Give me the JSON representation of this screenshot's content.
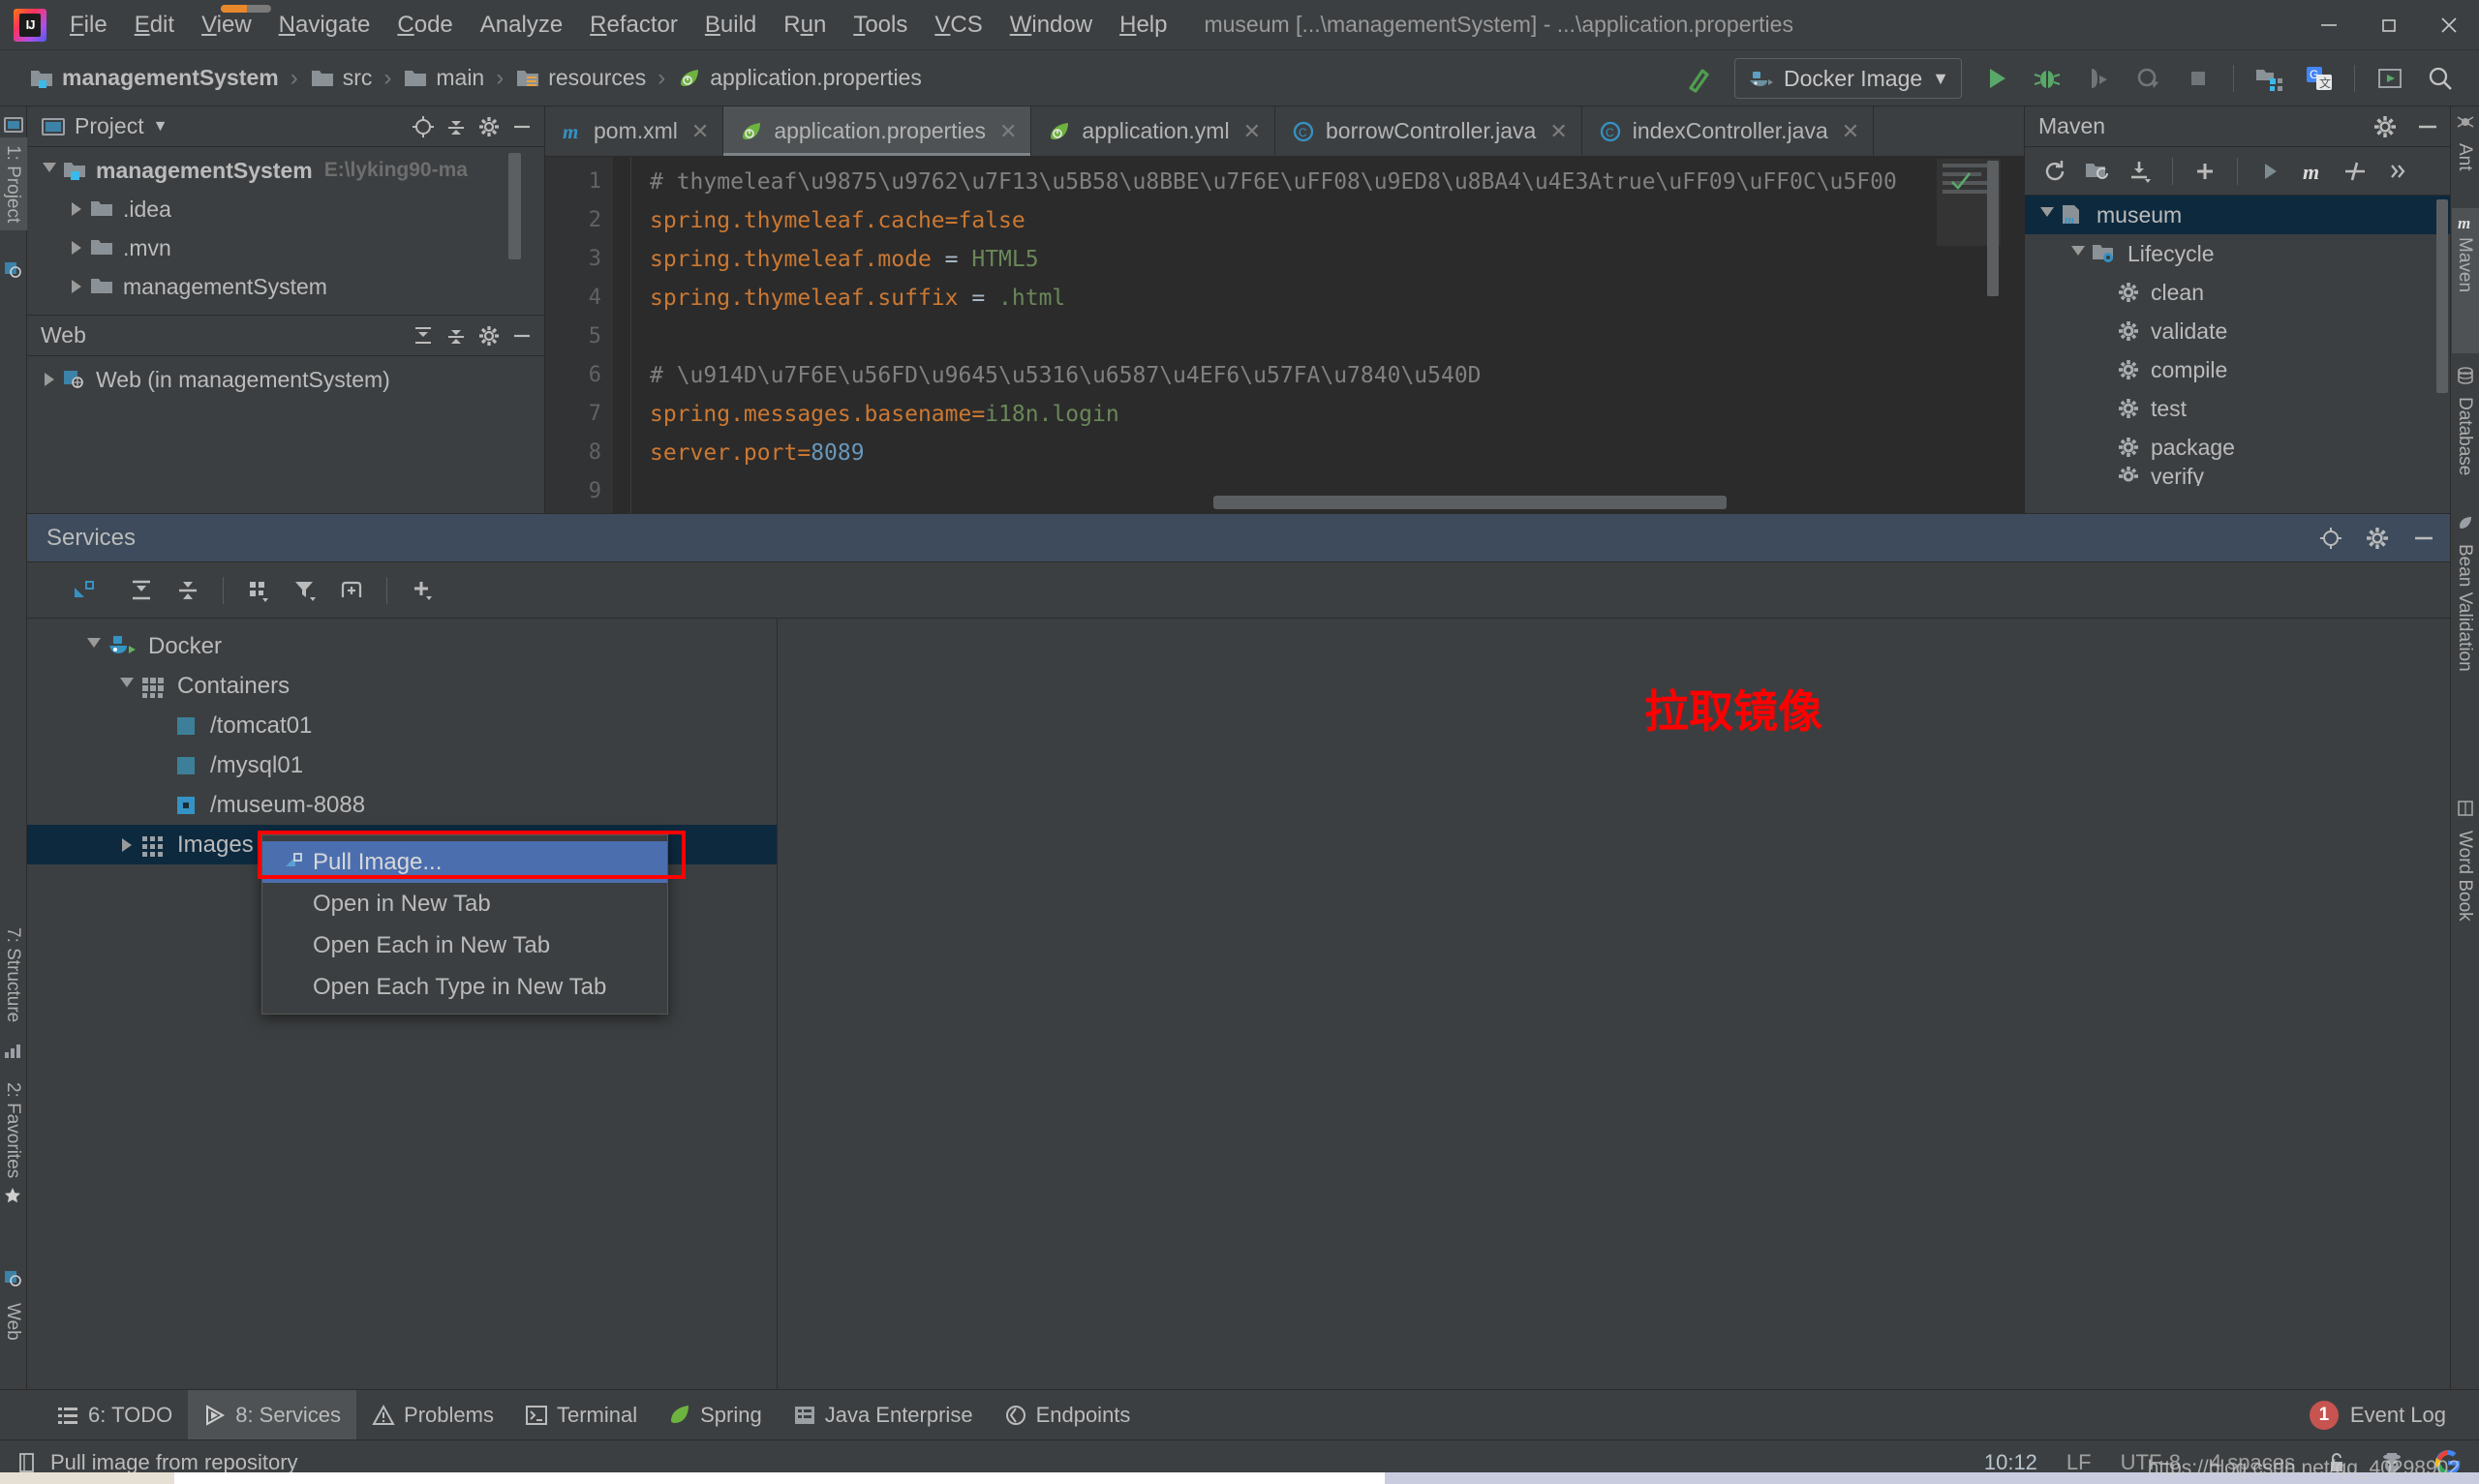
{
  "window": {
    "title": "museum [...\\managementSystem] - ...\\application.properties",
    "minimize": "—",
    "maximize": "❐",
    "close": "✕"
  },
  "menubar": {
    "items": [
      {
        "label": "File",
        "mnemonic": "F"
      },
      {
        "label": "Edit",
        "mnemonic": "E"
      },
      {
        "label": "View",
        "mnemonic": "V"
      },
      {
        "label": "Navigate",
        "mnemonic": "N"
      },
      {
        "label": "Code",
        "mnemonic": "C"
      },
      {
        "label": "Analyze",
        "mnemonic": ""
      },
      {
        "label": "Refactor",
        "mnemonic": "R"
      },
      {
        "label": "Build",
        "mnemonic": "B"
      },
      {
        "label": "Run",
        "mnemonic": "R"
      },
      {
        "label": "Tools",
        "mnemonic": "T"
      },
      {
        "label": "VCS",
        "mnemonic": "V"
      },
      {
        "label": "Window",
        "mnemonic": "W"
      },
      {
        "label": "Help",
        "mnemonic": "H"
      }
    ]
  },
  "breadcrumb": {
    "items": [
      {
        "label": "managementSystem",
        "icon": "module-folder-icon",
        "bold": true
      },
      {
        "label": "src",
        "icon": "folder-icon",
        "bold": false
      },
      {
        "label": "main",
        "icon": "folder-icon",
        "bold": false
      },
      {
        "label": "resources",
        "icon": "resources-folder-icon",
        "bold": false
      },
      {
        "label": "application.properties",
        "icon": "spring-leaf-icon",
        "bold": false
      }
    ]
  },
  "toolbar": {
    "build_icon": "hammer-icon",
    "run_config": "Docker Image",
    "run_config_icon": "docker-whale-icon",
    "dropdown_caret": "▼",
    "buttons": [
      {
        "name": "run-button",
        "icon": "play-icon"
      },
      {
        "name": "debug-button",
        "icon": "bug-icon"
      },
      {
        "name": "run-with-coverage-button",
        "icon": "coverage-icon"
      },
      {
        "name": "profile-button",
        "icon": "profiler-icon"
      },
      {
        "name": "stop-button",
        "icon": "stop-icon"
      },
      {
        "name": "project-structure-button",
        "icon": "project-structure-icon"
      },
      {
        "name": "translate-button",
        "icon": "google-translate-icon"
      },
      {
        "name": "run-anything-button",
        "icon": "terminal-run-icon"
      },
      {
        "name": "search-everywhere-button",
        "icon": "search-icon"
      }
    ]
  },
  "left_strip": {
    "tabs": [
      {
        "label": "1: Project",
        "active": true,
        "icon": "project-icon"
      },
      {
        "label": "7: Structure",
        "active": false,
        "icon": "structure-icon"
      },
      {
        "label": "2: Favorites",
        "active": false,
        "icon": "star-icon"
      },
      {
        "label": "Web",
        "active": false,
        "icon": "web-icon"
      }
    ]
  },
  "right_strip": {
    "tabs": [
      {
        "label": "Ant",
        "active": false,
        "icon": "ant-icon"
      },
      {
        "label": "Maven",
        "active": true,
        "icon": "maven-m-icon"
      },
      {
        "label": "Database",
        "active": false,
        "icon": "database-icon"
      },
      {
        "label": "Bean Validation",
        "active": false,
        "icon": "bean-icon"
      },
      {
        "label": "Word Book",
        "active": false,
        "icon": "book-icon"
      }
    ]
  },
  "project_panel": {
    "title": "Project",
    "caret": "▼",
    "header_buttons": [
      "locate-icon",
      "collapse-all-icon",
      "settings-icon",
      "hide-icon"
    ],
    "tree": [
      {
        "label": "managementSystem",
        "path": "E:\\lyking90-ma",
        "indent": 0,
        "expanded": true,
        "bold": true,
        "icon": "module-folder-icon"
      },
      {
        "label": ".idea",
        "path": "",
        "indent": 1,
        "expanded": false,
        "bold": false,
        "icon": "folder-icon"
      },
      {
        "label": ".mvn",
        "path": "",
        "indent": 1,
        "expanded": false,
        "bold": false,
        "icon": "folder-icon"
      },
      {
        "label": "managementSystem",
        "path": "",
        "indent": 1,
        "expanded": false,
        "bold": false,
        "icon": "folder-icon"
      }
    ]
  },
  "web_panel": {
    "title": "Web",
    "header_buttons": [
      "expand-all-icon",
      "collapse-all-icon",
      "settings-icon",
      "hide-icon"
    ],
    "tree": [
      {
        "label": "Web (in managementSystem)",
        "indent": 0,
        "expanded": false,
        "icon": "web-module-icon"
      }
    ]
  },
  "editor": {
    "tabs": [
      {
        "label": "pom.xml",
        "icon": "maven-m-icon",
        "active": false,
        "closable": true
      },
      {
        "label": "application.properties",
        "icon": "spring-leaf-icon",
        "active": true,
        "closable": true
      },
      {
        "label": "application.yml",
        "icon": "spring-leaf-icon",
        "active": false,
        "closable": true
      },
      {
        "label": "borrowController.java",
        "icon": "java-class-icon",
        "active": false,
        "closable": true
      },
      {
        "label": "indexController.java",
        "icon": "java-class-icon",
        "active": false,
        "closable": true
      }
    ],
    "line_numbers": [
      "1",
      "2",
      "3",
      "4",
      "5",
      "6",
      "7",
      "8",
      "9"
    ],
    "lines": [
      {
        "n": 1,
        "type": "comment",
        "text": "# thymeleaf\\u9875\\u9762\\u7F13\\u5B58\\u8BBE\\u7F6E\\uFF08\\u9ED8\\u8BA4\\u4E3Atrue\\uFF09\\uFF0C\\u5F00"
      },
      {
        "n": 2,
        "type": "prop",
        "key": "spring.thymeleaf.cache",
        "eq": "=",
        "value": "false",
        "valkind": "plain"
      },
      {
        "n": 3,
        "type": "prop",
        "key": "spring.thymeleaf.mode",
        "eq": " = ",
        "value": "HTML5",
        "valkind": "string"
      },
      {
        "n": 4,
        "type": "prop",
        "key": "spring.thymeleaf.suffix",
        "eq": " = ",
        "value": ".html",
        "valkind": "string"
      },
      {
        "n": 5,
        "type": "blank",
        "text": ""
      },
      {
        "n": 6,
        "type": "comment",
        "text": "# \\u914D\\u7F6E\\u56FD\\u9645\\u5316\\u6587\\u4EF6\\u57FA\\u7840\\u540D"
      },
      {
        "n": 7,
        "type": "prop",
        "key": "spring.messages.basename",
        "eq": "=",
        "value": "i18n.login",
        "valkind": "string"
      },
      {
        "n": 8,
        "type": "prop",
        "key": "server.port",
        "eq": "=",
        "value": "8089",
        "valkind": "number"
      },
      {
        "n": 9,
        "type": "blank",
        "text": ""
      }
    ]
  },
  "services": {
    "title": "Services",
    "header_buttons": [
      "locate-icon",
      "settings-icon",
      "hide-icon"
    ],
    "toolbar_buttons": [
      "restore-layout-icon",
      "expand-all-icon",
      "collapse-all-icon",
      "group-icon",
      "filter-icon",
      "add-tab-icon",
      "add-icon"
    ],
    "tree": [
      {
        "label": "Docker",
        "indent": 0,
        "expanded": true,
        "icon": "docker-whale-icon",
        "selected": false
      },
      {
        "label": "Containers",
        "indent": 1,
        "expanded": true,
        "icon": "grid-icon",
        "selected": false
      },
      {
        "label": "/tomcat01",
        "indent": 2,
        "expanded": null,
        "icon": "container-stopped-icon",
        "selected": false
      },
      {
        "label": "/mysql01",
        "indent": 2,
        "expanded": null,
        "icon": "container-stopped-icon",
        "selected": false
      },
      {
        "label": "/museum-8088",
        "indent": 2,
        "expanded": null,
        "icon": "container-running-icon",
        "selected": false
      },
      {
        "label": "Images",
        "indent": 1,
        "expanded": false,
        "icon": "grid-icon",
        "selected": true
      }
    ],
    "annotation": "拉取镜像"
  },
  "context_menu": {
    "items": [
      {
        "label": "Pull Image...",
        "icon": "pull-image-icon",
        "highlighted": true
      },
      {
        "label": "Open in New Tab",
        "icon": "",
        "highlighted": false
      },
      {
        "label": "Open Each in New Tab",
        "icon": "",
        "highlighted": false
      },
      {
        "label": "Open Each Type in New Tab",
        "icon": "",
        "highlighted": false
      }
    ],
    "highlight_color": "#4b6eaf",
    "annotation_box_color": "#ff0000"
  },
  "maven_panel": {
    "title": "Maven",
    "header_buttons": [
      "settings-icon",
      "hide-icon"
    ],
    "toolbar_buttons": [
      "reload-icon",
      "reload-project-icon",
      "download-sources-icon",
      "add-icon",
      "run-icon",
      "maven-m-icon",
      "toggle-skip-tests-icon",
      "more-icon"
    ],
    "tree": [
      {
        "label": "museum",
        "indent": 0,
        "expanded": true,
        "icon": "maven-project-icon",
        "selected": true
      },
      {
        "label": "Lifecycle",
        "indent": 1,
        "expanded": true,
        "icon": "lifecycle-folder-icon",
        "selected": false
      },
      {
        "label": "clean",
        "indent": 2,
        "expanded": null,
        "icon": "gear-icon",
        "selected": false
      },
      {
        "label": "validate",
        "indent": 2,
        "expanded": null,
        "icon": "gear-icon",
        "selected": false
      },
      {
        "label": "compile",
        "indent": 2,
        "expanded": null,
        "icon": "gear-icon",
        "selected": false
      },
      {
        "label": "test",
        "indent": 2,
        "expanded": null,
        "icon": "gear-icon",
        "selected": false
      },
      {
        "label": "package",
        "indent": 2,
        "expanded": null,
        "icon": "gear-icon",
        "selected": false
      },
      {
        "label": "verify",
        "indent": 2,
        "expanded": null,
        "icon": "gear-icon",
        "selected": false
      }
    ]
  },
  "bottom_bar": {
    "tabs": [
      {
        "label": "6: TODO",
        "mnemonic": "6",
        "icon": "todo-icon",
        "active": false
      },
      {
        "label": "8: Services",
        "mnemonic": "8",
        "icon": "services-icon",
        "active": true
      },
      {
        "label": "Problems",
        "mnemonic": "",
        "icon": "warning-icon",
        "active": false
      },
      {
        "label": "Terminal",
        "mnemonic": "",
        "icon": "terminal-icon",
        "active": false
      },
      {
        "label": "Spring",
        "mnemonic": "",
        "icon": "spring-leaf-icon",
        "active": false
      },
      {
        "label": "Java Enterprise",
        "mnemonic": "",
        "icon": "java-ee-icon",
        "active": false
      },
      {
        "label": "Endpoints",
        "mnemonic": "",
        "icon": "endpoints-icon",
        "active": false
      }
    ],
    "event_log": {
      "label": "Event Log",
      "badge": "1",
      "badge_color": "#c75450"
    }
  },
  "status_bar": {
    "message": "Pull image from repository",
    "message_icon": "info-icon",
    "time": "10:12",
    "line_separator": "LF",
    "encoding": "UTF-8",
    "indent": "4 spaces",
    "lock_icon": "unlocked-icon",
    "inspector_icon": "hector-icon",
    "google_icon": "google-icon"
  },
  "watermark": "https://blog.csdn.net/qq_40298902"
}
